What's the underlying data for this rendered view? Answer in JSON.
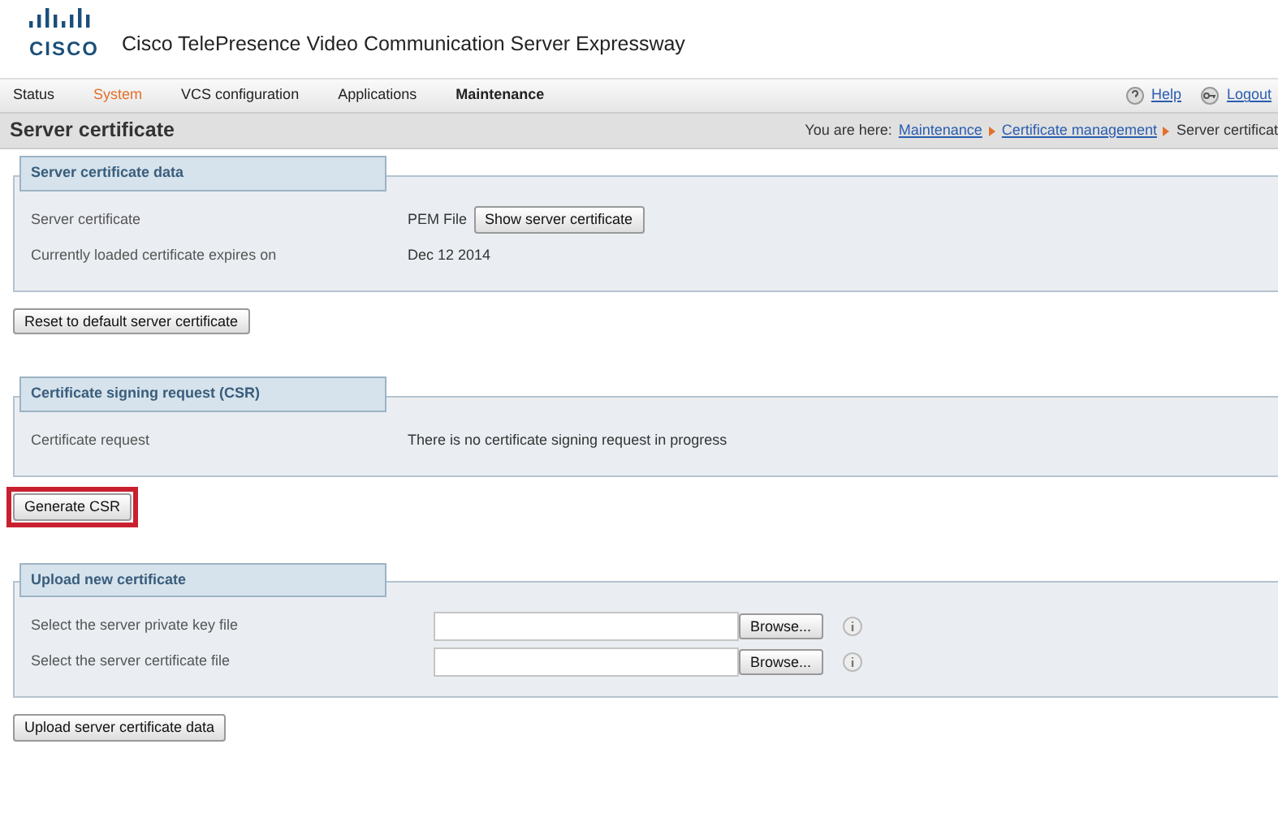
{
  "header": {
    "logo_text": "CISCO",
    "product": "Cisco TelePresence  Video Communication Server Expressway"
  },
  "nav": [
    {
      "label": "Status",
      "selected": false,
      "highlighted": false
    },
    {
      "label": "System",
      "selected": false,
      "highlighted": true
    },
    {
      "label": "VCS configuration",
      "selected": false,
      "highlighted": false
    },
    {
      "label": "Applications",
      "selected": false,
      "highlighted": false
    },
    {
      "label": "Maintenance",
      "selected": true,
      "highlighted": false
    }
  ],
  "nav_links": [
    "Help",
    "Logout"
  ],
  "page_title": "Server certificate",
  "breadcrumb": {
    "prefix": "You are here:",
    "links": [
      "Maintenance",
      "Certificate management"
    ],
    "current": "Server certificat"
  },
  "sections": [
    {
      "title": "Server certificate data",
      "rows": [
        {
          "label": "Server certificate",
          "value": "PEM File",
          "button": "Show server certificate"
        },
        {
          "label": "Currently loaded certificate expires on",
          "value": "Dec 12 2014"
        }
      ],
      "action": {
        "label": "Reset to default server certificate",
        "highlighted": false
      }
    },
    {
      "title": "Certificate signing request (CSR)",
      "rows": [
        {
          "label": "Certificate request",
          "value": "There is no certificate signing request in progress"
        }
      ],
      "action": {
        "label": "Generate CSR",
        "highlighted": true
      }
    },
    {
      "title": "Upload new certificate",
      "rows": [
        {
          "label": "Select the server private key file",
          "file": "Browse..."
        },
        {
          "label": "Select the server certificate file",
          "file": "Browse..."
        }
      ],
      "action": {
        "label": "Upload server certificate data",
        "highlighted": false
      }
    }
  ]
}
